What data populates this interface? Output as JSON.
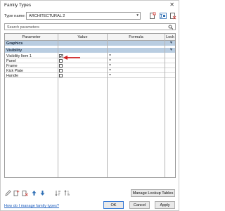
{
  "window": {
    "title": "Family Types",
    "close_glyph": "✕"
  },
  "type_name": {
    "label": "Type name:",
    "value": "ARCHITECTURAL 2",
    "arrow": "▾"
  },
  "search": {
    "placeholder": "Search parameters"
  },
  "table": {
    "headers": {
      "parameter": "Parameter",
      "value": "Value",
      "formula": "Formula",
      "lock": "Lock"
    },
    "groups": [
      {
        "label": "Graphics",
        "collapse_glyph": "¥"
      },
      {
        "label": "Visibility",
        "collapse_glyph": "¥"
      }
    ],
    "rows": [
      {
        "name": "Visibility Item 1",
        "checked": true,
        "formula": "="
      },
      {
        "name": "Panel",
        "checked": false,
        "formula": "="
      },
      {
        "name": "Frame",
        "checked": false,
        "formula": "="
      },
      {
        "name": "Kick Plate",
        "checked": false,
        "formula": "="
      },
      {
        "name": "Handle",
        "checked": false,
        "formula": "="
      }
    ]
  },
  "annotation": {
    "arrow_color": "#d11f1f"
  },
  "buttons": {
    "manage_lookup": "Manage Lookup Tables",
    "ok": "OK",
    "cancel": "Cancel",
    "apply": "Apply"
  },
  "help_link": "How do I manage family types?",
  "icons": {
    "toolbar": [
      "new-type-icon",
      "rename-type-icon",
      "delete-type-icon"
    ],
    "bottom": [
      "edit-parameter-icon",
      "new-parameter-icon",
      "delete-parameter-icon",
      "move-up-icon",
      "move-down-icon",
      "sort-ascending-icon",
      "sort-descending-icon"
    ]
  }
}
